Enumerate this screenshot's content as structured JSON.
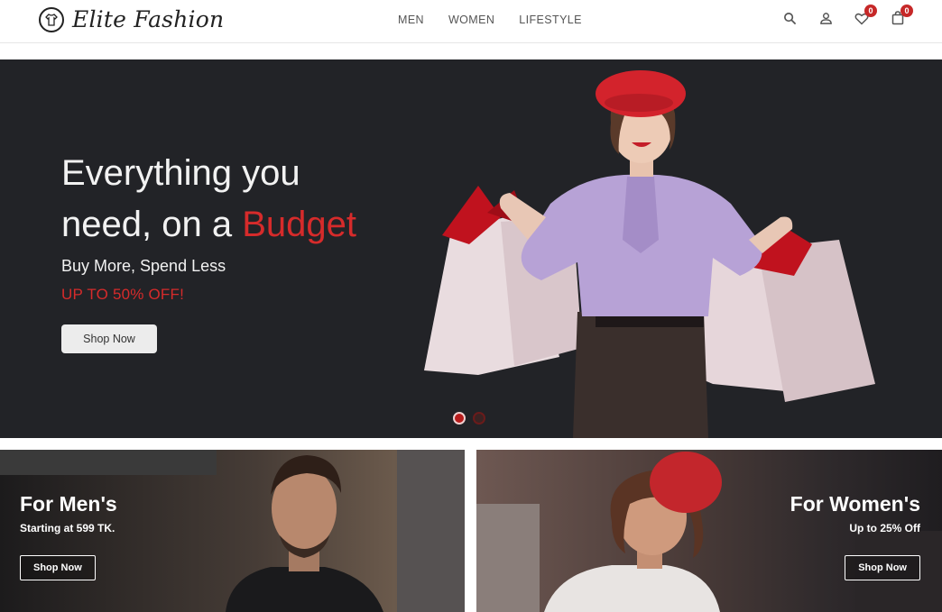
{
  "brand": {
    "name": "Elite Fashion",
    "logo_icon": "shirt-logo-icon"
  },
  "nav": {
    "items": [
      {
        "label": "MEN"
      },
      {
        "label": "WOMEN"
      },
      {
        "label": "LIFESTYLE"
      }
    ]
  },
  "header_icons": {
    "search": "search-icon",
    "account": "user-icon",
    "wishlist": {
      "icon": "heart-icon",
      "count": "0"
    },
    "cart": {
      "icon": "bag-icon",
      "count": "0"
    }
  },
  "hero": {
    "title_line1": "Everything you",
    "title_line2_prefix": "need, on a ",
    "title_accent": "Budget",
    "subtitle": "Buy More, Spend Less",
    "offer": "UP TO 50% OFF!",
    "cta": "Shop Now",
    "slides": {
      "count": 2,
      "active": 1
    }
  },
  "categories": {
    "men": {
      "title": "For Men's",
      "subtitle": "Starting at 599 TK.",
      "cta": "Shop Now"
    },
    "women": {
      "title": "For Women's",
      "subtitle": "Up to 25% Off",
      "cta": "Shop Now"
    }
  },
  "colors": {
    "accent": "#d62b2b",
    "hero_bg": "#222327",
    "badge": "#c62828"
  }
}
